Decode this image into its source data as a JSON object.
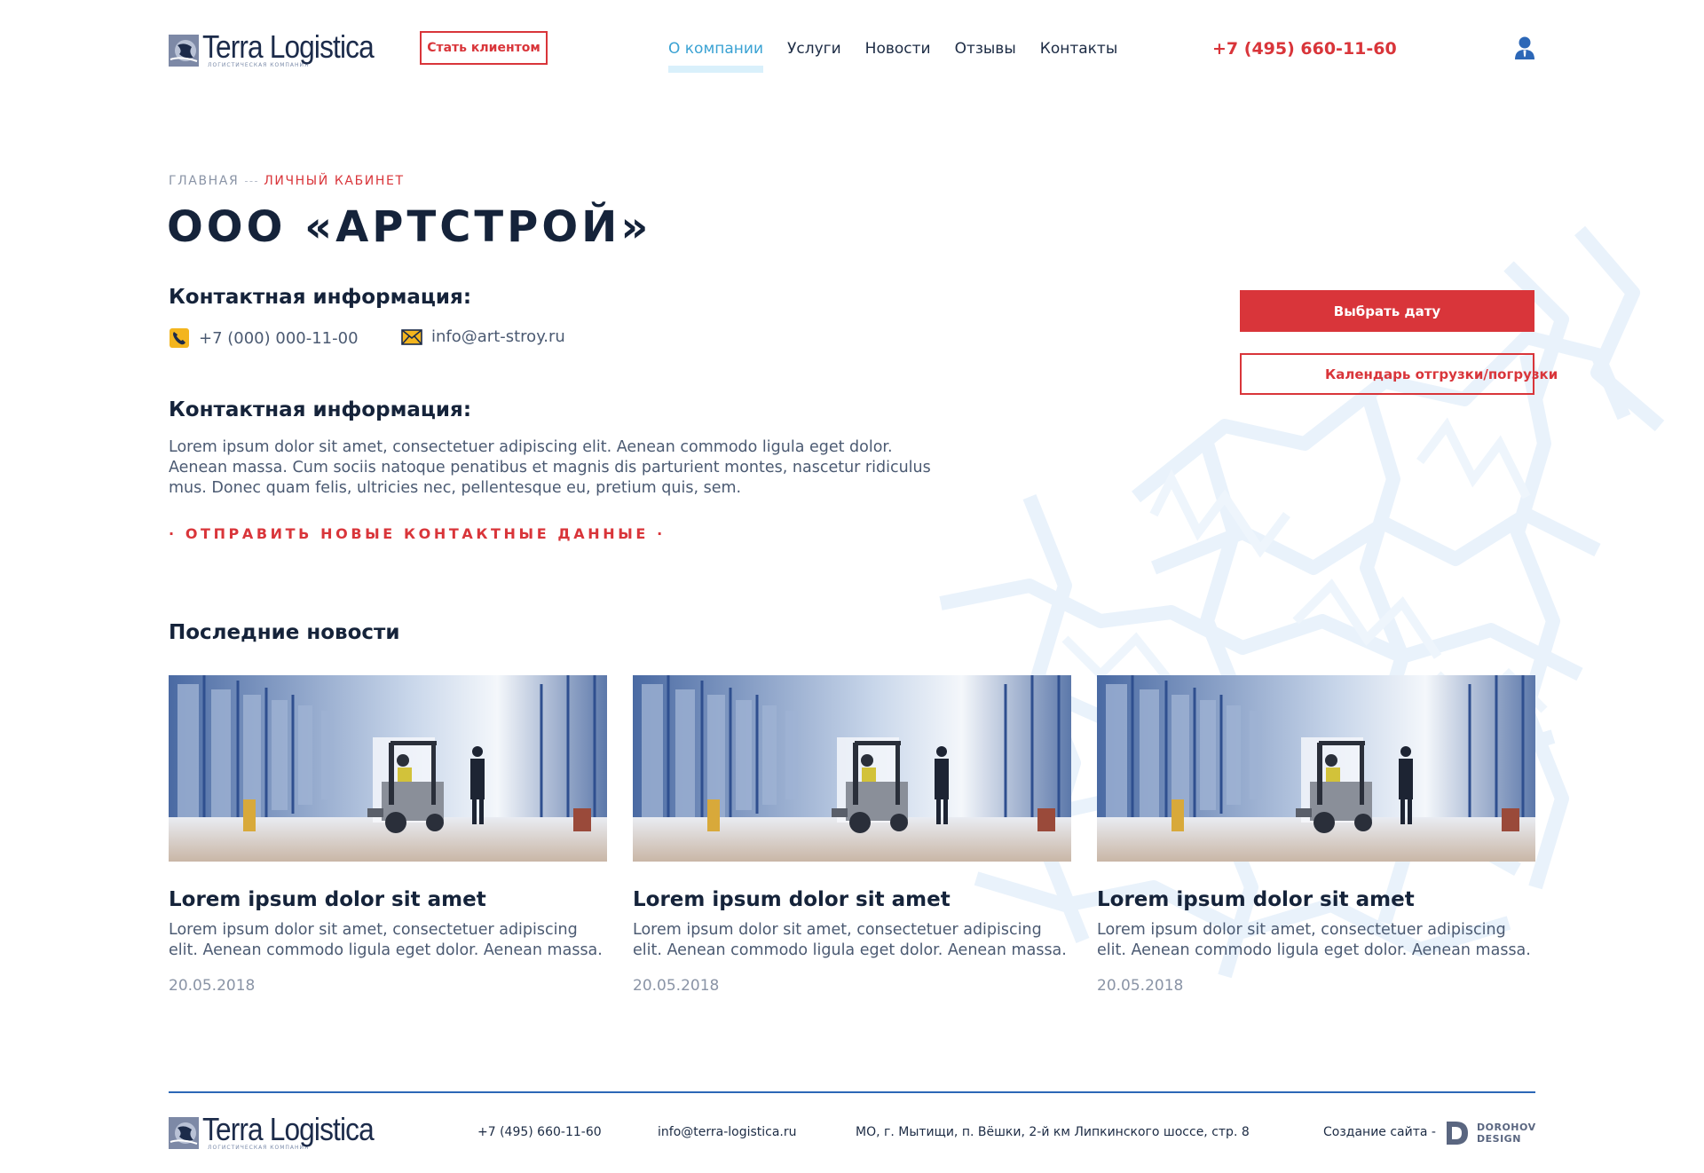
{
  "header": {
    "logo": {
      "name": "Terra Logistica",
      "tagline": "ЛОГИСТИЧЕСКАЯ КОМПАНИЯ"
    },
    "become_client": "Стать клиентом",
    "nav": [
      {
        "label": "О компании",
        "active": true
      },
      {
        "label": "Услуги"
      },
      {
        "label": "Новости"
      },
      {
        "label": "Отзывы"
      },
      {
        "label": "Контакты"
      }
    ],
    "phone": "+7 (495) 660-11-60",
    "user_icon": "user-icon"
  },
  "breadcrumb": {
    "home": "ГЛАВНАЯ",
    "current": "ЛИЧНЫЙ КАБИНЕТ"
  },
  "page_title": "ООО «АРТСТРОЙ»",
  "contacts": {
    "heading": "Контактная информация:",
    "phone": "+7 (000) 000-11-00",
    "email": "info@art-stroy.ru"
  },
  "about": {
    "heading": "Контактная информация:",
    "text": "Lorem ipsum dolor sit amet, consectetuer adipiscing elit. Aenean commodo ligula eget dolor. Aenean massa. Cum sociis natoque penatibus et magnis dis parturient montes, nascetur ridiculus mus. Donec quam felis, ultricies nec, pellentesque eu, pretium quis, sem.",
    "send_link": "· ОТПРАВИТЬ НОВЫЕ КОНТАКТНЫЕ ДАННЫЕ ·"
  },
  "actions": {
    "choose_date": "Выбрать дату",
    "calendar": "Календарь отгрузки/погрузки"
  },
  "news": {
    "heading": "Последние новости",
    "items": [
      {
        "title": "Lorem ipsum dolor sit amet",
        "text": "Lorem ipsum dolor sit amet, consectetuer adipiscing elit. Aenean commodo ligula eget dolor. Aenean massa.",
        "date": "20.05.2018"
      },
      {
        "title": "Lorem ipsum dolor sit amet",
        "text": "Lorem ipsum dolor sit amet, consectetuer adipiscing elit. Aenean commodo ligula eget dolor. Aenean massa.",
        "date": "20.05.2018"
      },
      {
        "title": "Lorem ipsum dolor sit amet",
        "text": "Lorem ipsum dolor sit amet, consectetuer adipiscing elit. Aenean commodo ligula eget dolor. Aenean massa.",
        "date": "20.05.2018"
      }
    ]
  },
  "footer": {
    "logo": {
      "name": "Terra Logistica",
      "tagline": "ЛОГИСТИЧЕСКАЯ КОМПАНИЯ"
    },
    "phone": "+7 (495) 660-11-60",
    "email": "info@terra-logistica.ru",
    "address": "МО, г. Мытищи, п. Вёшки, 2-й км Липкинского шоссе, стр. 8",
    "credit": "Создание сайта -",
    "studio": {
      "line1": "DOROHOV",
      "line2": "DESIGN"
    }
  },
  "colors": {
    "accent_red": "#d9353a",
    "nav_active": "#3aa2d3",
    "dark": "#15233a",
    "footer_line": "#2c67b7"
  }
}
